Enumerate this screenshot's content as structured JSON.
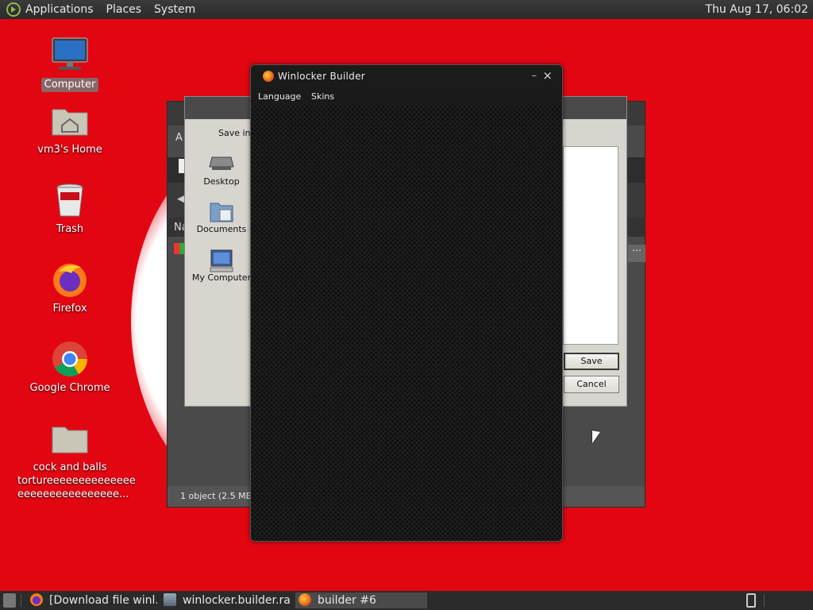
{
  "top_panel": {
    "menus": [
      "Applications",
      "Places",
      "System"
    ],
    "clock": "Thu Aug 17, 06:02"
  },
  "desktop_icons": [
    {
      "label": "Computer",
      "icon": "computer-icon",
      "selected": true
    },
    {
      "label": "vm3's Home",
      "icon": "home-folder-icon"
    },
    {
      "label": "Trash",
      "icon": "trash-icon"
    },
    {
      "label": "Firefox",
      "icon": "firefox-icon"
    },
    {
      "label": "Google Chrome",
      "icon": "chrome-icon"
    },
    {
      "label_lines": [
        "cock and balls",
        "tortureeeeeeeeeeeeee",
        "eeeeeeeeeeeeeeee..."
      ],
      "icon": "folder-icon"
    }
  ],
  "file_manager": {
    "status": "1 object (2.5 MB), 1",
    "side_text_a": "A",
    "side_text_na": "Na",
    "overflow": "⋯"
  },
  "save_dialog": {
    "save_in_label": "Save in:",
    "places": [
      "Desktop",
      "Documents",
      "My Computer"
    ],
    "save_label": "Save",
    "cancel_label": "Cancel"
  },
  "winlocker": {
    "title": "Winlocker Builder",
    "menus": [
      "Language",
      "Skins"
    ],
    "minimize_glyph": "–",
    "close_glyph": "×"
  },
  "taskbar": {
    "items": [
      {
        "label": "[Download file winl…",
        "icon": "firefox-icon"
      },
      {
        "label": "winlocker.builder.ra…",
        "icon": "archive-icon"
      },
      {
        "label": "builder #6",
        "icon": "winlocker-icon",
        "active": true
      }
    ]
  },
  "colors": {
    "desktop_bg": "#e20612",
    "panel_bg": "#2b2b2b",
    "winlocker_bg": "#1e1e1e"
  }
}
